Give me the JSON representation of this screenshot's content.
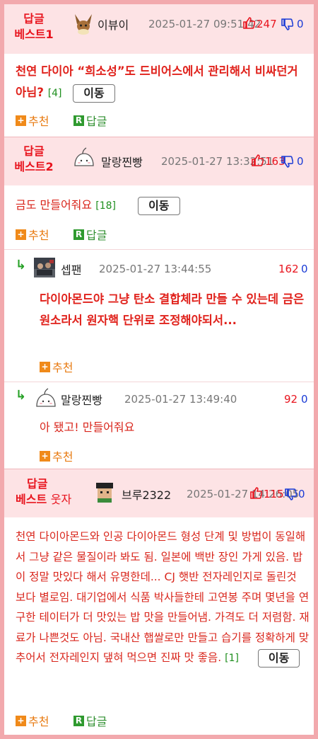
{
  "posts": [
    {
      "best_label": "답글\n베스트1",
      "nickname": "이뷰이",
      "date": "2025-01-27 09:51:42",
      "up": "247",
      "down": "0",
      "body": "천연 다이아 “희소성”도 드비어스에서 관리해서 비싸던거 아님?",
      "count": "[4]",
      "move_label": "이동",
      "recommend_label": "추천",
      "reply_label": "답글"
    },
    {
      "best_label": "답글\n베스트2",
      "nickname": "말랑찐빵",
      "date": "2025-01-27 13:32:51",
      "up": "163",
      "down": "0",
      "body": "금도 만들어줘요",
      "count": "[18]",
      "move_label": "이동",
      "recommend_label": "추천",
      "reply_label": "답글"
    },
    {
      "best_label_line1": "답글",
      "best_label_line2a": "베스트",
      "best_label_line2b": "웃자",
      "nickname": "브루2322",
      "date": "2025-01-27 14:26:05",
      "up": "115",
      "down": "0",
      "body": "천연 다이아몬드와 인공 다이아몬드 형성 단계 및 방법이 동일해서 그냥 같은 물질이라 봐도 됨. 일본에 백반 장인 가게 있음. 밥이 정말 맛있다 해서 유명한데... CJ 햇반 전자레인지로 돌린것 보다 별로임. 대기업에서 식품 박사들한테 고연봉 주며 몇년을 연구한 테이터가 더 맛있는 밥 맛을 만들어냄. 가격도 더 저렴함. 재료가 나쁜것도 아님. 국내산 햅쌀로만 만들고 습기를 정확하게 맞추어서 전자레인지 댚혀 먹으면 진짜 맛 좋음.",
      "count": "[1]",
      "move_label": "이동",
      "recommend_label": "추천",
      "reply_label": "답글"
    }
  ],
  "replies": [
    {
      "arrow": "↳",
      "nickname": "셉팬",
      "date": "2025-01-27 13:44:55",
      "up": "162",
      "down": "0",
      "body": "다이아몬드야 그냥 탄소 결합체라 만들 수 있는데 금은 원소라서 원자핵 단위로 조정해야되서...",
      "recommend_label": "추천"
    },
    {
      "arrow": "↳",
      "nickname": "말랑찐빵",
      "date": "2025-01-27 13:49:40",
      "up": "92",
      "down": "0",
      "body": "아 됐고! 만들어줘요",
      "recommend_label": "추천"
    }
  ],
  "icons": {
    "plus_glyph": "+",
    "r_glyph": "R",
    "thumb_up_color": "#e8141e",
    "thumb_down_color": "#1a3bd6"
  }
}
